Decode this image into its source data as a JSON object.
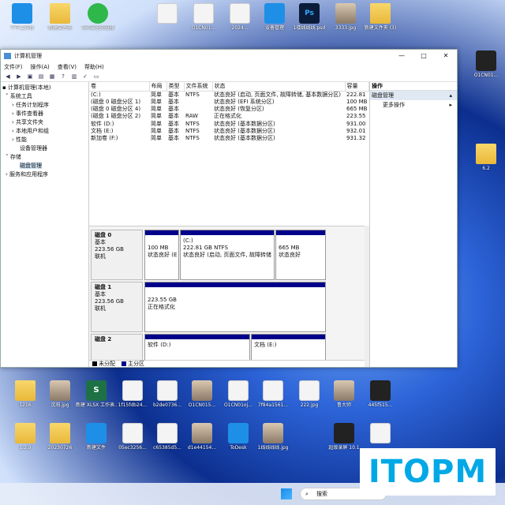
{
  "desktop_top": [
    "千牛工作台",
    "新建文件夹",
    "360安全浏览器",
    "",
    "",
    "",
    "",
    "",
    "",
    "",
    ""
  ],
  "desktop_top_extra": [
    "O1CN01...",
    "2024...",
    "设备管理",
    "1楼线线线.psd",
    "3333.jpg",
    "新建文件夹 (3)"
  ],
  "desktop_right": [
    "O1CN01...",
    "6.2"
  ],
  "desktop_bottom1": [
    "1.2",
    "1216",
    "沈阳.jpg",
    "新建 XLSX 工作表.xlsx",
    "1f15fdb24...",
    "b2de0736...",
    "O1CN015...",
    "O1CN01oj...",
    "7f84a1561...",
    "222.jpg",
    "鲁大师",
    "445f515..."
  ],
  "desktop_bottom2": [
    "0",
    "1.2.9",
    "20230726",
    "新建文件",
    "05ec3256...",
    "c65385d5...",
    "d1e44154...",
    "ToDesk",
    "1线线线线.jpg",
    "超级录屏 10.1",
    ""
  ],
  "window": {
    "title": "计算机管理",
    "menu": [
      "文件(F)",
      "操作(A)",
      "查看(V)",
      "帮助(H)"
    ]
  },
  "tree": [
    {
      "label": "计算机管理(本地)",
      "indent": 0
    },
    {
      "label": "系统工具",
      "indent": 1
    },
    {
      "label": "任务计划程序",
      "indent": 2
    },
    {
      "label": "事件查看器",
      "indent": 2
    },
    {
      "label": "共享文件夹",
      "indent": 2
    },
    {
      "label": "本地用户和组",
      "indent": 2
    },
    {
      "label": "性能",
      "indent": 2
    },
    {
      "label": "设备管理器",
      "indent": 2
    },
    {
      "label": "存储",
      "indent": 1
    },
    {
      "label": "磁盘管理",
      "indent": 2
    },
    {
      "label": "服务和应用程序",
      "indent": 1
    }
  ],
  "columns": [
    "卷",
    "布局",
    "类型",
    "文件系统",
    "状态",
    "容量"
  ],
  "volumes": [
    [
      "(C:)",
      "简单",
      "基本",
      "NTFS",
      "状态良好 (启动, 页面文件, 故障转储, 基本数据分区)",
      "222.81"
    ],
    [
      "(磁盘 0 磁盘分区 1)",
      "简单",
      "基本",
      "",
      "状态良好 (EFI 系统分区)",
      "100 MB"
    ],
    [
      "(磁盘 0 磁盘分区 4)",
      "简单",
      "基本",
      "",
      "状态良好 (恢复分区)",
      "665 MB"
    ],
    [
      "(磁盘 1 磁盘分区 2)",
      "简单",
      "基本",
      "RAW",
      "正在格式化",
      "223.55"
    ],
    [
      "软件 (D:)",
      "简单",
      "基本",
      "NTFS",
      "状态良好 (基本数据分区)",
      "931.00"
    ],
    [
      "文档 (E:)",
      "简单",
      "基本",
      "NTFS",
      "状态良好 (基本数据分区)",
      "932.01"
    ],
    [
      "新加卷 (F:)",
      "简单",
      "基本",
      "NTFS",
      "状态良好 (基本数据分区)",
      "931.32"
    ]
  ],
  "disks": [
    {
      "name": "磁盘 0",
      "type": "基本",
      "size": "223.56 GB",
      "status": "联机"
    },
    {
      "name": "磁盘 1",
      "type": "基本",
      "size": "223.56 GB",
      "status": "联机"
    },
    {
      "name": "磁盘 2",
      "type": "基本",
      "size": "",
      "status": ""
    }
  ],
  "parts": {
    "d0p1": {
      "line1": "100 MB",
      "line2": "状态良好 (E"
    },
    "d0p2": {
      "title": "(C:)",
      "line1": "222.81 GB NTFS",
      "line2": "状态良好 (启动, 页面文件, 故障转储"
    },
    "d0p3": {
      "line1": "665 MB",
      "line2": "状态良好"
    },
    "d1p1": {
      "line1": "223.55 GB",
      "line2": "正在格式化"
    },
    "d2p1": {
      "title": "软件 (D:)"
    },
    "d2p2": {
      "title": "文档 (E:)"
    }
  },
  "legend": [
    "未分配",
    "主分区"
  ],
  "legend_colors": {
    "unallocated": "#000000",
    "primary": "#00008b"
  },
  "actions": {
    "header": "操作",
    "section": "磁盘管理",
    "more": "更多操作"
  },
  "taskbar": {
    "search": "搜索"
  },
  "brand": "ITOPM"
}
